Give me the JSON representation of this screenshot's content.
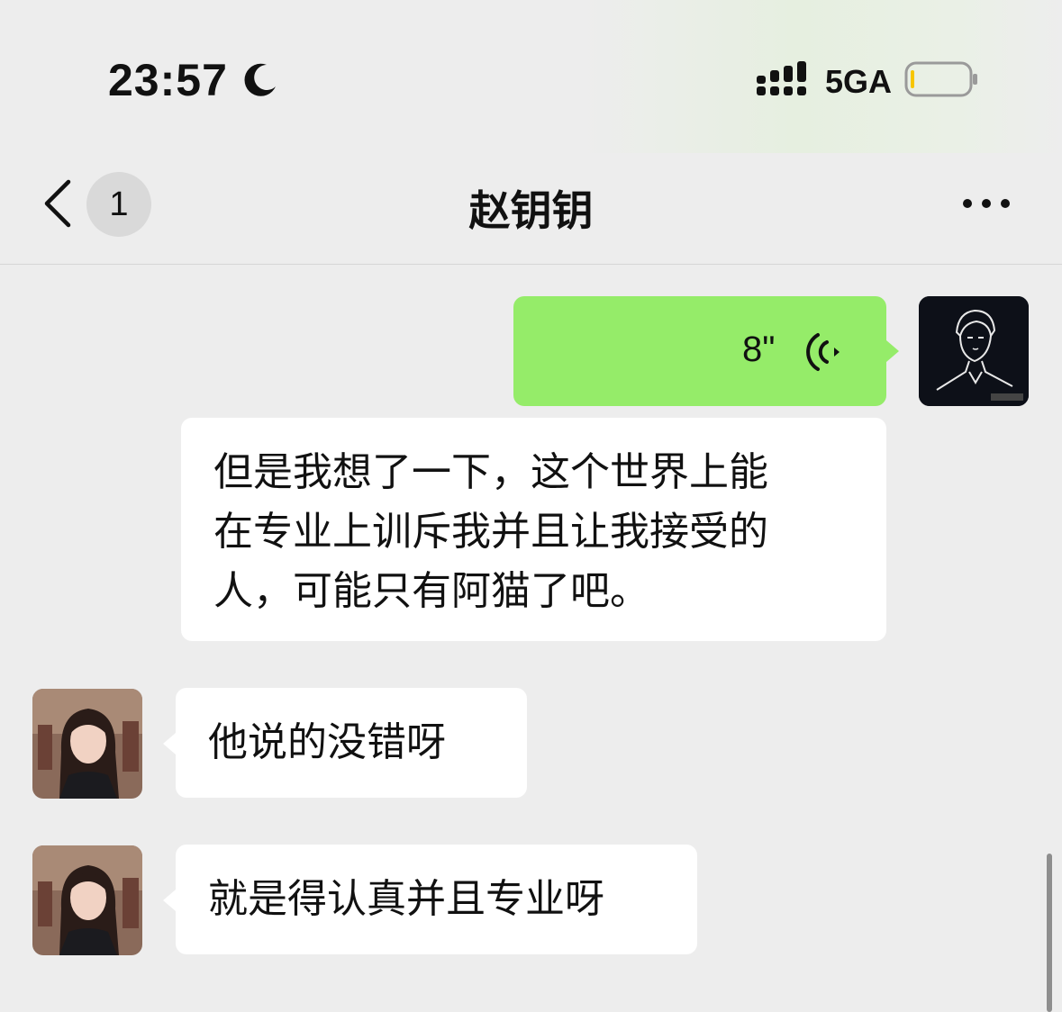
{
  "status_bar": {
    "time": "23:57",
    "network": "5GA",
    "icons": [
      "moon-icon",
      "signal-icon",
      "battery-icon"
    ]
  },
  "header": {
    "back_icon": "chevron-left-icon",
    "unread_count": "1",
    "title": "赵钥钥",
    "more_icon": "more-dots-icon"
  },
  "messages": [
    {
      "sender": "me",
      "type": "voice",
      "duration": "8\""
    },
    {
      "sender": "me",
      "type": "text",
      "lines": [
        "但是我想了一下，这个世界上能",
        "在专业上训斥我并且让我接受的",
        "人，可能只有阿猫了吧。"
      ]
    },
    {
      "sender": "other",
      "type": "text",
      "text": "他说的没错呀"
    },
    {
      "sender": "other",
      "type": "text",
      "text": "就是得认真并且专业呀"
    }
  ],
  "colors": {
    "background": "#ededed",
    "my_bubble": "#95ec69",
    "other_bubble": "#ffffff",
    "battery_low": "#f7c600"
  }
}
